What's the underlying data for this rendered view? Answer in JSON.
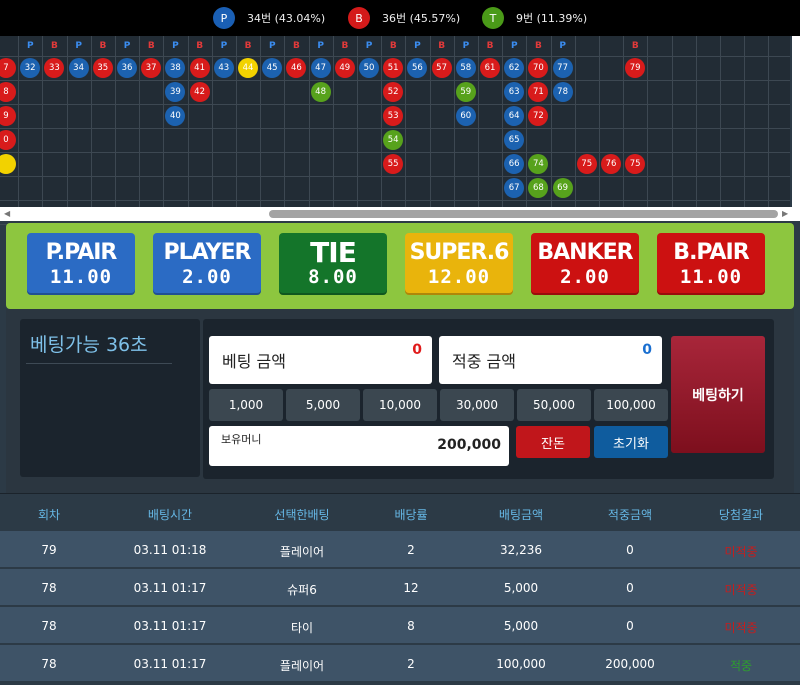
{
  "legend": [
    {
      "letter": "P",
      "text": "34번 (43.04%)",
      "color": "#1a5fb4"
    },
    {
      "letter": "B",
      "text": "36번 (45.57%)",
      "color": "#d41a1a"
    },
    {
      "letter": "T",
      "text": "9번 (11.39%)",
      "color": "#4a9a18"
    }
  ],
  "colors": {
    "P": "#1c62b0",
    "B": "#d81b1b",
    "T": "#57a21c",
    "Y": "#f2d200"
  },
  "grid_header": [
    "P",
    "B",
    "P",
    "B",
    "P",
    "B",
    "P",
    "B",
    "P",
    "B",
    "P",
    "B",
    "P",
    "B",
    "P",
    "B",
    "P",
    "B",
    "P",
    "B",
    "P",
    "B",
    "P",
    "",
    "",
    "B"
  ],
  "grid_columns": [
    [
      [
        "B",
        "7"
      ],
      [
        "B",
        "8"
      ],
      [
        "B",
        "9"
      ],
      [
        "B",
        "0"
      ],
      [
        "Y",
        ""
      ],
      [
        "",
        ""
      ]
    ],
    [
      [
        "P",
        "32"
      ]
    ],
    [
      [
        "B",
        "33"
      ]
    ],
    [
      [
        "P",
        "34"
      ]
    ],
    [
      [
        "B",
        "35"
      ]
    ],
    [
      [
        "P",
        "36"
      ]
    ],
    [
      [
        "B",
        "37"
      ]
    ],
    [
      [
        "P",
        "38"
      ],
      [
        "P",
        "39"
      ],
      [
        "P",
        "40"
      ]
    ],
    [
      [
        "B",
        "41"
      ],
      [
        "B",
        "42"
      ]
    ],
    [
      [
        "P",
        "43"
      ]
    ],
    [
      [
        "Y",
        "44"
      ]
    ],
    [
      [
        "P",
        "45"
      ]
    ],
    [
      [
        "B",
        "46"
      ]
    ],
    [
      [
        "P",
        "47"
      ],
      [
        "T",
        "48"
      ]
    ],
    [
      [
        "B",
        "49"
      ]
    ],
    [
      [
        "P",
        "50"
      ]
    ],
    [
      [
        "B",
        "51"
      ],
      [
        "B",
        "52"
      ],
      [
        "B",
        "53"
      ],
      [
        "T",
        "54"
      ],
      [
        "B",
        "55"
      ]
    ],
    [
      [
        "P",
        "56"
      ]
    ],
    [
      [
        "B",
        "57"
      ]
    ],
    [
      [
        "P",
        "58"
      ],
      [
        "T",
        "59"
      ],
      [
        "P",
        "60"
      ]
    ],
    [
      [
        "B",
        "61"
      ]
    ],
    [
      [
        "P",
        "62"
      ],
      [
        "P",
        "63"
      ],
      [
        "P",
        "64"
      ],
      [
        "P",
        "65"
      ],
      [
        "P",
        "66"
      ],
      [
        "P",
        "67"
      ]
    ],
    [
      [
        "B",
        "70"
      ],
      [
        "B",
        "71"
      ],
      [
        "B",
        "72"
      ],
      [
        "",
        ""
      ],
      [
        "T",
        "74"
      ],
      [
        "T",
        "68"
      ]
    ],
    [
      [
        "P",
        "77"
      ],
      [
        "P",
        "78"
      ],
      [
        "",
        ""
      ],
      [
        "",
        ""
      ],
      [
        "",
        ""
      ],
      [
        "T",
        "69"
      ]
    ],
    [
      [
        "",
        ""
      ],
      [
        "",
        ""
      ],
      [
        "",
        ""
      ],
      [
        "",
        ""
      ],
      [
        "B",
        "75"
      ]
    ],
    [
      [
        "",
        ""
      ],
      [
        "",
        ""
      ],
      [
        "",
        ""
      ],
      [
        "",
        ""
      ],
      [
        "B",
        "76"
      ]
    ],
    [
      [
        "B",
        "79"
      ],
      [
        "",
        ""
      ],
      [
        "",
        ""
      ],
      [
        "",
        ""
      ],
      [
        "B",
        "75"
      ]
    ]
  ],
  "bets": [
    {
      "name": "P.PAIR",
      "odds": "11.00",
      "color": "#2b6bc4"
    },
    {
      "name": "PLAYER",
      "odds": "2.00",
      "color": "#2b6bc4"
    },
    {
      "name": "TIE",
      "odds": "8.00",
      "color": "#14752a"
    },
    {
      "name": "SUPER.6",
      "odds": "12.00",
      "color": "#e9b40c"
    },
    {
      "name": "BANKER",
      "odds": "2.00",
      "color": "#cc1111"
    },
    {
      "name": "B.PAIR",
      "odds": "11.00",
      "color": "#cc1111"
    }
  ],
  "timer_text": "베팅가능 36초",
  "bet_amount_label": "베팅 금액",
  "bet_amount_value": "0",
  "win_amount_label": "적중 금액",
  "win_amount_value": "0",
  "chips": [
    "1,000",
    "5,000",
    "10,000",
    "30,000",
    "50,000",
    "100,000"
  ],
  "money_label": "보유머니",
  "money_value": "200,000",
  "btn_change": "잔돈",
  "btn_reset": "초기화",
  "btn_place": "베팅하기",
  "table": {
    "headers": [
      "회차",
      "배팅시간",
      "선택한배팅",
      "배당률",
      "배팅금액",
      "적중금액",
      "당첨결과"
    ],
    "rows": [
      [
        "79",
        "03.11 01:18",
        "플레이어",
        "2",
        "32,236",
        "0",
        "미적중"
      ],
      [
        "78",
        "03.11 01:17",
        "슈퍼6",
        "12",
        "5,000",
        "0",
        "미적중"
      ],
      [
        "78",
        "03.11 01:17",
        "타이",
        "8",
        "5,000",
        "0",
        "미적중"
      ],
      [
        "78",
        "03.11 01:17",
        "플레이어",
        "2",
        "100,000",
        "200,000",
        "적중"
      ]
    ],
    "result_colors": {
      "미적중": "#c61d1d",
      "적중": "#2e9e2e"
    }
  }
}
